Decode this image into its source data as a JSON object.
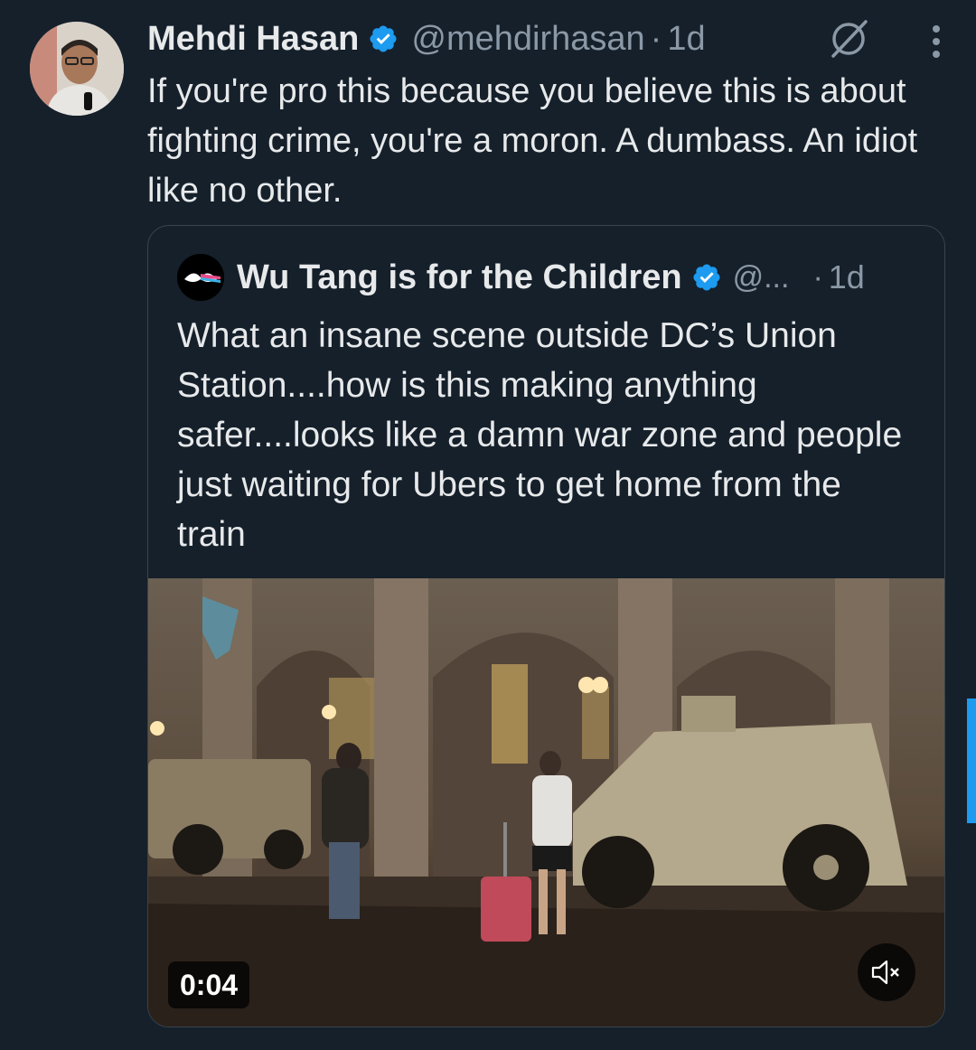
{
  "tweet": {
    "author_name": "Mehdi Hasan",
    "handle": "@mehdirhasan",
    "separator": "·",
    "time": "1d",
    "text": "If you're pro this because you believe this is about fighting crime, you're a moron. A dumbass. An idiot like no other."
  },
  "quoted_tweet": {
    "author_name": "Wu Tang is for the Children",
    "handle": "@...",
    "separator": "·",
    "time": "1d",
    "text": "What an insane scene outside DC’s Union Station....how is this making anything safer....looks like a damn war zone and people just waiting for Ubers to get home from the train",
    "media": {
      "duration": "0:04",
      "muted": true
    }
  },
  "colors": {
    "background": "#15202b",
    "text": "#e7e9ea",
    "secondary": "#8b98a5",
    "accent": "#1d9bf0",
    "border": "#38444d"
  },
  "icons": [
    "verified-badge-icon",
    "grok-icon",
    "more-options-icon",
    "mute-icon"
  ]
}
